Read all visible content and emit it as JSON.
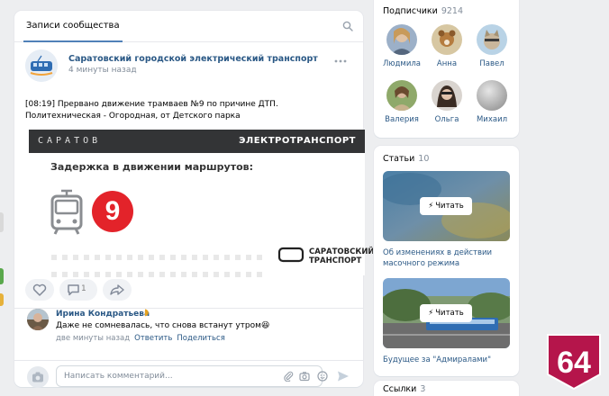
{
  "feed": {
    "tab_label": "Записи сообщества",
    "post": {
      "author": "Саратовский городской электрический транспорт",
      "time": "4 минуты назад",
      "text": "[08:19] Прервано движение трамваев №9 по причине ДТП. Политехническая - Огородная, от Детского парка",
      "banner": {
        "left_word": "САРАТОВ",
        "right_word": "ЭЛЕКТРОТРАНСПОРТ",
        "headline": "Задержка в движении маршрутов:",
        "route_number": "9",
        "brand_line1": "САРАТОВСКИЙ",
        "brand_line2": "ТРАНСПОРТ"
      },
      "comments_count": "1"
    },
    "comment": {
      "author": "Ирина Кондратьева",
      "text": "Даже не сомневалась, что снова встанут утром😆",
      "time": "две минуты назад",
      "reply_label": "Ответить",
      "share_label": "Поделиться"
    },
    "composer_placeholder": "Написать комментарий..."
  },
  "members": {
    "title": "Подписчики",
    "count": "9214",
    "people": [
      {
        "name": "Людмила"
      },
      {
        "name": "Анна"
      },
      {
        "name": "Павел"
      },
      {
        "name": "Валерия"
      },
      {
        "name": "Ольга"
      },
      {
        "name": "Михаил"
      }
    ]
  },
  "articles": {
    "title": "Статьи",
    "count": "10",
    "read_label": "Читать",
    "items": [
      {
        "title": "Об изменениях в действии масочного режима"
      },
      {
        "title": "Будущее за \"Адмиралами\""
      }
    ]
  },
  "links": {
    "title": "Ссылки",
    "count": "3"
  },
  "badge": {
    "number": "64"
  },
  "colors": {
    "link": "#2a5885",
    "accent": "#5181b8",
    "route_red": "#e3232a",
    "badge_red": "#b5154b"
  }
}
